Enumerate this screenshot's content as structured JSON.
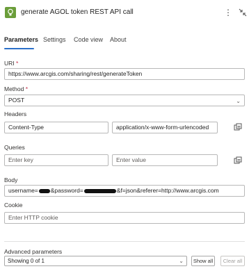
{
  "header": {
    "title": "generate AGOL token REST API call",
    "app_icon": "bulb-icon",
    "more_icon": "more-vertical-icon",
    "collapse_icon": "collapse-arrows-icon",
    "accent": "#6b9e3a"
  },
  "tabs": [
    {
      "label": "Parameters",
      "active": true
    },
    {
      "label": "Settings",
      "active": false
    },
    {
      "label": "Code view",
      "active": false
    },
    {
      "label": "About",
      "active": false
    }
  ],
  "uri": {
    "label": "URI",
    "required_mark": "*",
    "value": "https://www.arcgis.com/sharing/rest/generateToken"
  },
  "method": {
    "label": "Method",
    "required_mark": "*",
    "value": "POST"
  },
  "headers": {
    "label": "Headers",
    "key_value": "Content-Type",
    "value_value": "application/x-www-form-urlencoded"
  },
  "queries": {
    "label": "Queries",
    "key_placeholder": "Enter key",
    "value_placeholder": "Enter value"
  },
  "body": {
    "label": "Body",
    "prefix": "username=",
    "middle": "&password=",
    "suffix": "&f=json&referer=http://www.arcgis.com"
  },
  "cookie": {
    "label": "Cookie",
    "placeholder": "Enter HTTP cookie"
  },
  "advanced": {
    "label": "Advanced parameters",
    "select_value": "Showing 0 of 1",
    "show_all": "Show all",
    "clear_all": "Clear all"
  }
}
